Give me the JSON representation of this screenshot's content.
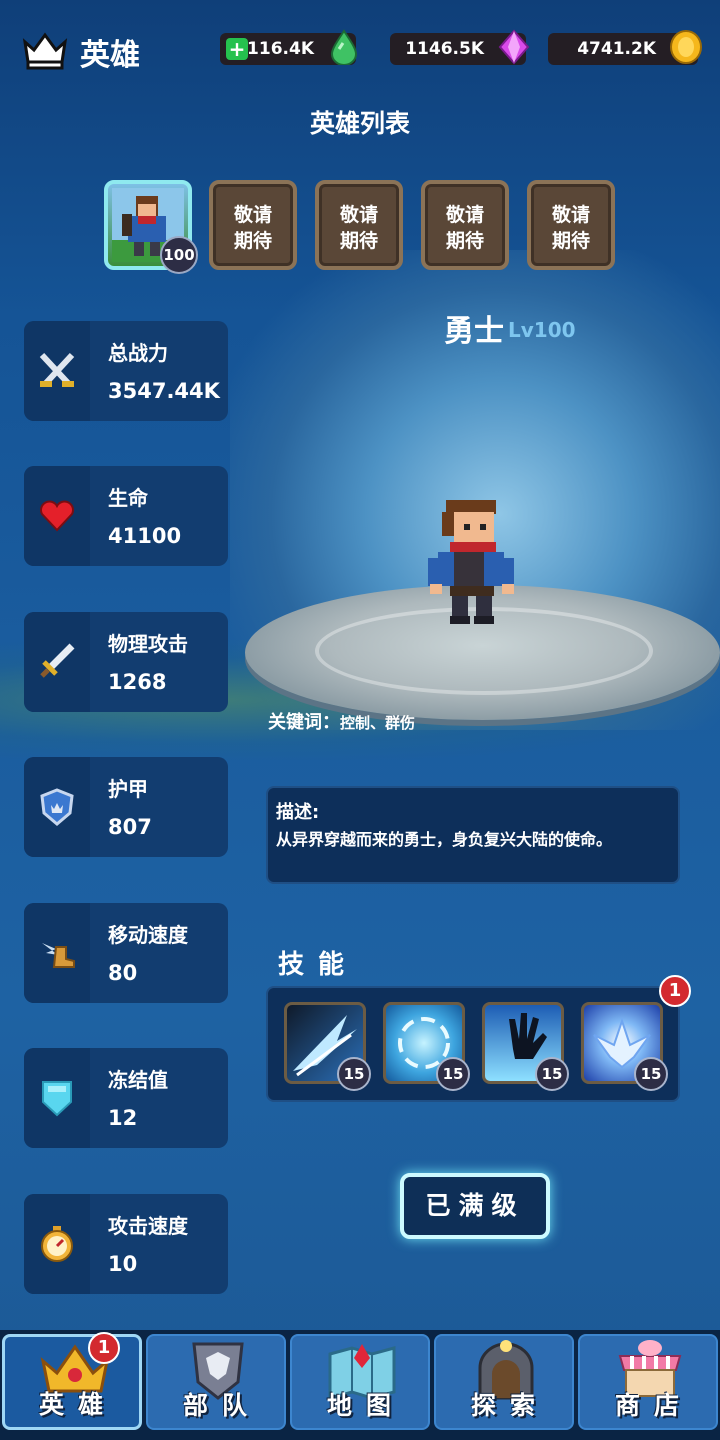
{
  "header": {
    "title": "英雄",
    "resources": [
      {
        "value": "1116.4K",
        "icon": "green-gem-icon"
      },
      {
        "value": "1146.5K",
        "icon": "purple-gem-icon"
      },
      {
        "value": "4741.2K",
        "icon": "gold-coin-icon"
      }
    ]
  },
  "hero_list": {
    "title": "英雄列表",
    "active_level": "100",
    "locked_label_1": "敬请",
    "locked_label_2": "期待"
  },
  "hero": {
    "name": "勇士",
    "level": "Lv100",
    "keywords_label": "关键词：",
    "keywords": "控制、群伤",
    "desc_label": "描述:",
    "desc": "从异界穿越而来的勇士，身负复兴大陆的使命。"
  },
  "stats": [
    {
      "label": "总战力",
      "value": "3547.44K",
      "icon": "crossed-swords-icon"
    },
    {
      "label": "生命",
      "value": "41100",
      "icon": "heart-icon"
    },
    {
      "label": "物理攻击",
      "value": "1268",
      "icon": "sword-icon"
    },
    {
      "label": "护甲",
      "value": "807",
      "icon": "shield-icon"
    },
    {
      "label": "移动速度",
      "value": "80",
      "icon": "winged-boot-icon"
    },
    {
      "label": "冻结值",
      "value": "12",
      "icon": "ice-shield-icon"
    },
    {
      "label": "攻击速度",
      "value": "10",
      "icon": "stopwatch-icon"
    }
  ],
  "skills": {
    "title": "技能",
    "notification": "1",
    "items": [
      {
        "level": "15",
        "icon": "ice-spikes-icon"
      },
      {
        "level": "15",
        "icon": "ice-vortex-icon"
      },
      {
        "level": "15",
        "icon": "shadow-hand-icon"
      },
      {
        "level": "15",
        "icon": "ice-phoenix-icon"
      }
    ]
  },
  "max_button": "已满级",
  "nav": {
    "hero_badge": "1",
    "items": [
      {
        "label": "英雄",
        "icon": "crown-icon"
      },
      {
        "label": "部队",
        "icon": "eagle-crest-icon"
      },
      {
        "label": "地图",
        "icon": "map-icon"
      },
      {
        "label": "探索",
        "icon": "mine-entrance-icon"
      },
      {
        "label": "商店",
        "icon": "shop-stall-icon"
      }
    ]
  }
}
